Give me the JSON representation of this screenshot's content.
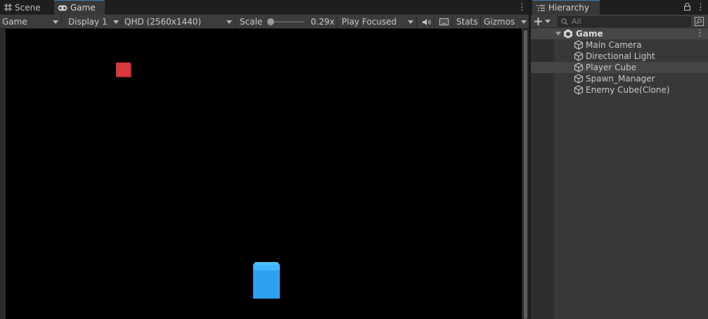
{
  "game_view": {
    "tabs": [
      {
        "label": "Scene",
        "icon": "grid-icon",
        "active": false
      },
      {
        "label": "Game",
        "icon": "gamepad-icon",
        "active": true
      }
    ],
    "toolbar": {
      "view_select": "Game",
      "display_select": "Display 1",
      "resolution_select": "QHD (2560x1440)",
      "scale_label": "Scale",
      "scale_value": "0.29x",
      "scale_fraction": 0.05,
      "play_mode_select": "Play Focused",
      "audio_icon": "speaker-icon",
      "shortcuts_icon": "keyboard-icon",
      "stats_label": "Stats",
      "gizmos_label": "Gizmos"
    },
    "scene_objects": [
      {
        "name": "Enemy Cube(Clone)",
        "color": "#d9383d"
      },
      {
        "name": "Player Cube",
        "color": "#2d9fef"
      }
    ],
    "background_color": "#000000"
  },
  "hierarchy": {
    "tab_label": "Hierarchy",
    "search_placeholder": "All",
    "root": {
      "label": "Game",
      "icon": "unity-scene-icon",
      "expanded": true
    },
    "items": [
      {
        "label": "Main Camera",
        "icon": "cube-icon",
        "selected": false
      },
      {
        "label": "Directional Light",
        "icon": "cube-icon",
        "selected": false
      },
      {
        "label": "Player Cube",
        "icon": "cube-icon",
        "selected": true
      },
      {
        "label": "Spawn_Manager",
        "icon": "cube-icon",
        "selected": false
      },
      {
        "label": "Enemy Cube(Clone)",
        "icon": "cube-icon",
        "selected": false
      }
    ]
  }
}
